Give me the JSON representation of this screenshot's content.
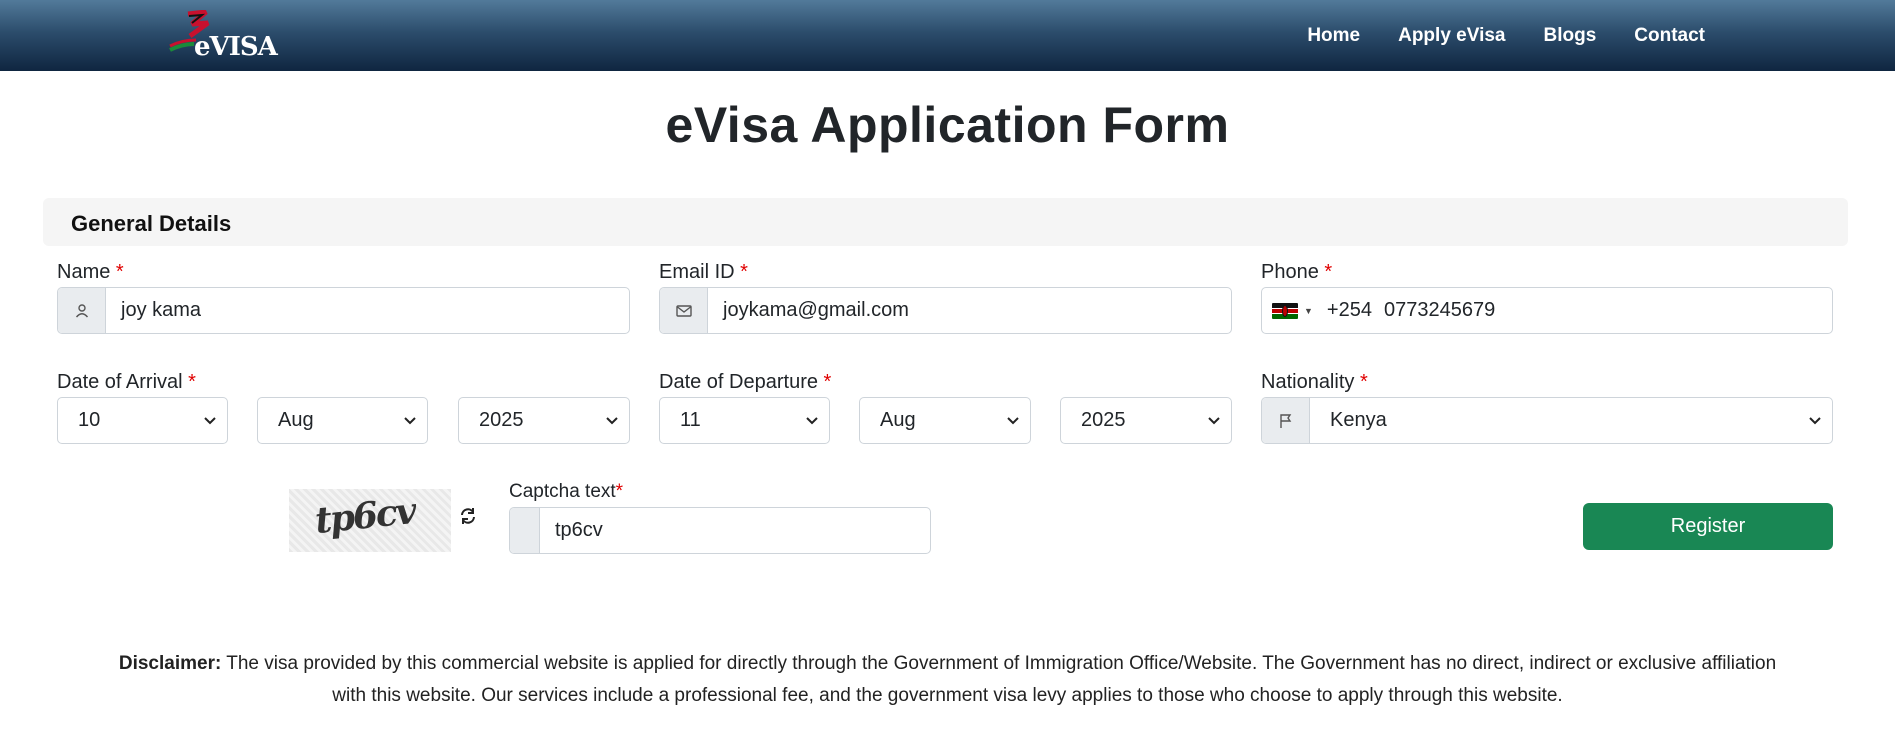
{
  "header": {
    "logo_text": "eVISA",
    "nav": [
      "Home",
      "Apply eVisa",
      "Blogs",
      "Contact"
    ]
  },
  "page_title": "eVisa Application Form",
  "section_title": "General Details",
  "fields": {
    "name": {
      "label": "Name",
      "required": "*",
      "value": "joy kama",
      "icon": "user-icon"
    },
    "email": {
      "label": "Email ID",
      "required": "*",
      "value": "joykama@gmail.com",
      "icon": "envelope-icon"
    },
    "phone": {
      "label": "Phone",
      "required": "*",
      "dial_code": "+254",
      "value": "0773245679",
      "country_flag": "kenya-flag-icon"
    },
    "arrival": {
      "label": "Date of Arrival",
      "required": "*",
      "day": "10",
      "month": "Aug",
      "year": "2025"
    },
    "departure": {
      "label": "Date of Departure",
      "required": "*",
      "day": "11",
      "month": "Aug",
      "year": "2025"
    },
    "nationality": {
      "label": "Nationality",
      "required": "*",
      "value": "Kenya",
      "icon": "flag-icon"
    },
    "captcha": {
      "label": "Captcha text",
      "required": "*",
      "image_text": "tp6cv",
      "value": "tp6cv"
    }
  },
  "register_label": "Register",
  "disclaimer": {
    "bold": "Disclaimer:",
    "text": "The visa provided by this commercial website is applied for directly through the Government of Immigration Office/Website. The Government has no direct, indirect or exclusive affiliation with this website. Our services include a professional fee, and the government visa levy applies to those who choose to apply through this website."
  },
  "colors": {
    "header_top": "#527a9a",
    "header_bottom": "#0f2640",
    "register_button": "#198754",
    "required_star": "#e00000"
  }
}
